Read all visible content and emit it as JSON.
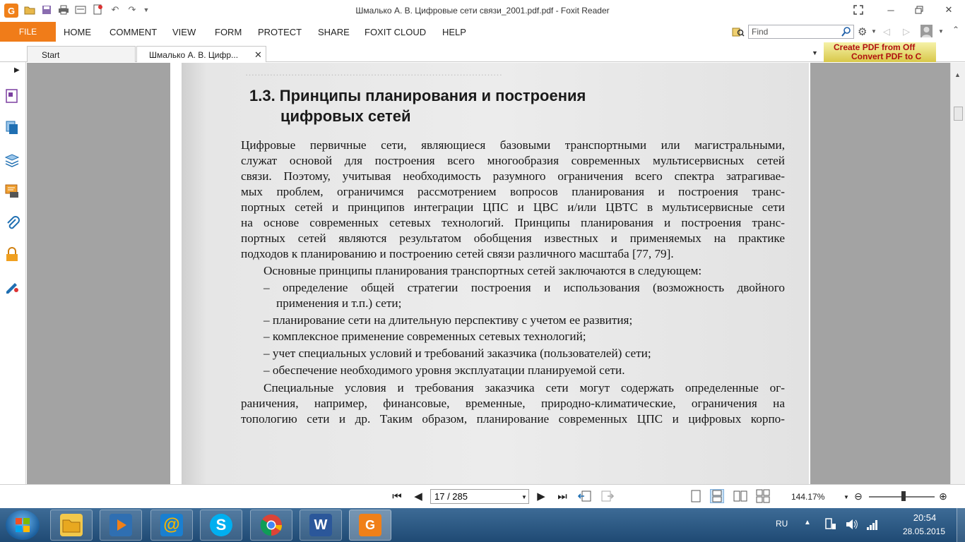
{
  "window": {
    "title": "Шмалько А. В. Цифровые сети связи_2001.pdf.pdf - Foxit Reader"
  },
  "ribbon": {
    "file_label": "FILE",
    "menu": [
      "HOME",
      "COMMENT",
      "VIEW",
      "FORM",
      "PROTECT",
      "SHARE",
      "FOXIT CLOUD",
      "HELP"
    ],
    "find_placeholder": "Find"
  },
  "tabs": [
    {
      "label": "Start"
    },
    {
      "label": "Шмалько А. В. Цифр..."
    }
  ],
  "ad_banner": {
    "line1": "Create PDF from Off",
    "line2": "Convert PDF to C"
  },
  "document": {
    "heading_line1": "1.3.  Принципы планирования и построения",
    "heading_line2": "цифровых сетей",
    "paragraph1": [
      "Цифровые первичные сети, являющиеся базовыми транспортными или магистральными,",
      "служат основой для построения всего многообразия современных мультисервисных сетей",
      "связи. Поэтому, учитывая необходимость разумного ограничения всего спектра затрагивае-",
      "мых проблем, ограничимся рассмотрением вопросов планирования и построения транс-",
      "портных сетей и принципов интеграции ЦПС и ЦВС и/или ЦВТС в мультисервисные сети",
      "на основе современных сетевых технологий. Принципы планирования и построения транс-",
      "портных сетей являются результатом обобщения известных и применяемых на практике",
      "подходов к планированию и построению сетей связи различного масштаба [77, 79]."
    ],
    "paragraph2": "Основные принципы планирования транспортных сетей заключаются в следующем:",
    "bullets": [
      "– определение общей стратегии построения и использования (возможность двойного",
      "применения и т.п.) сети;",
      "– планирование сети на длительную перспективу с учетом ее развития;",
      "– комплексное применение современных сетевых технологий;",
      "– учет специальных условий и требований заказчика (пользователей) сети;",
      "– обеспечение необходимого уровня эксплуатации планируемой сети."
    ],
    "paragraph3": [
      "Специальные условия и требования заказчика сети могут содержать определенные ог-",
      "раничения, например, финансовые, временные, природно-климатические, ограничения на",
      "топологию сети и др. Таким образом, планирование современных ЦПС и цифровых корпо-"
    ]
  },
  "statusbar": {
    "page_value": "17 / 285",
    "zoom": "144.17%"
  },
  "taskbar": {
    "language": "RU",
    "time": "20:54",
    "date": "28.05.2015"
  },
  "colors": {
    "accent": "#f07c19",
    "doc_background": "#a3a3a3",
    "taskbar": "#2a5683"
  }
}
